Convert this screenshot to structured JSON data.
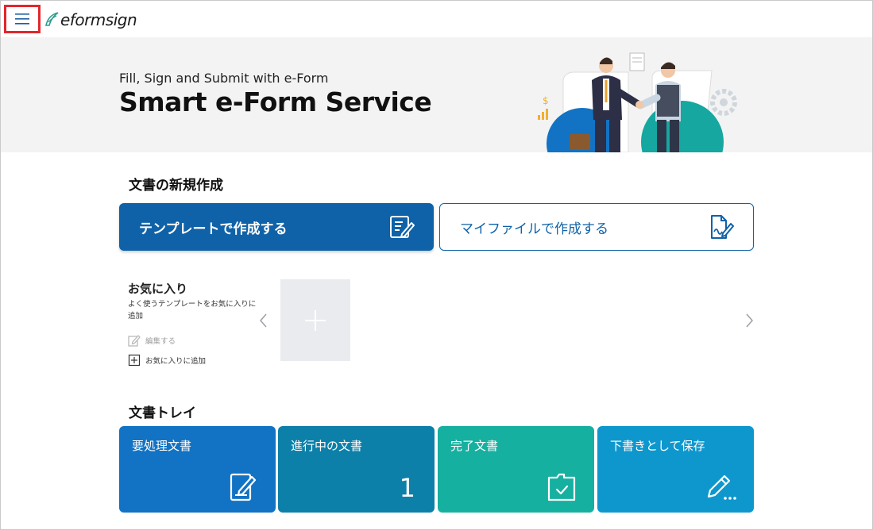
{
  "header": {
    "menu_icon": "hamburger-icon",
    "logo_text": "eformsign"
  },
  "hero": {
    "subtitle": "Fill, Sign and Submit with e-Form",
    "title": "Smart e-Form Service"
  },
  "new_document": {
    "heading": "文書の新規作成",
    "template_button": "テンプレートで作成する",
    "myfile_button": "マイファイルで作成する"
  },
  "favorites": {
    "title": "お気に入り",
    "description": "よく使うテンプレートをお気に入りに追加",
    "edit_label": "編集する",
    "add_label": "お気に入りに追加"
  },
  "tray": {
    "heading": "文書トレイ",
    "tiles": [
      {
        "label": "要処理文書",
        "icon": "edit-document-icon",
        "count": ""
      },
      {
        "label": "進行中の文書",
        "icon": "",
        "count": "1"
      },
      {
        "label": "完了文書",
        "icon": "folder-check-icon",
        "count": ""
      },
      {
        "label": "下書きとして保存",
        "icon": "pencil-dots-icon",
        "count": ""
      }
    ]
  },
  "colors": {
    "primary": "#0f62a8",
    "tile_action": "#1273c4",
    "tile_progress": "#0d80a9",
    "tile_complete": "#16b0a0",
    "tile_draft": "#0e97cd",
    "highlight": "#e2262b",
    "logo_accent": "#2a9d8f"
  }
}
